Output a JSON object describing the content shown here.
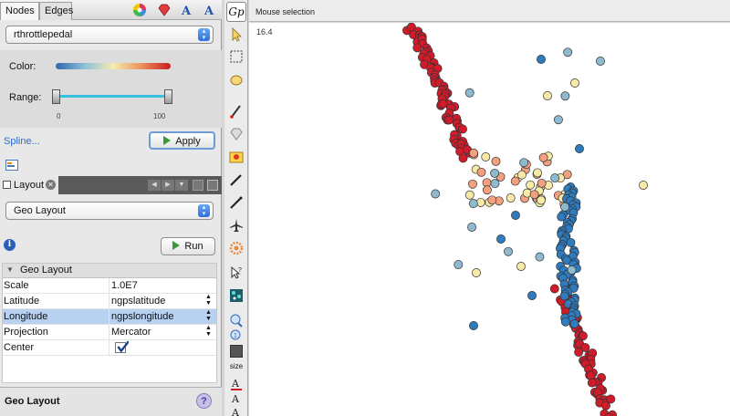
{
  "left_panel": {
    "tabs": [
      "Nodes",
      "Edges"
    ],
    "ranking": {
      "attribute": "rthrottlepedal",
      "color_label": "Color:",
      "range_label": "Range:",
      "range_min": "0",
      "range_max": "100",
      "spline_link": "Spline...",
      "apply_button": "Apply",
      "range_low_percent": 0,
      "range_high_percent": 100
    },
    "layout_panel": {
      "tab_label": "Layout",
      "selected_layout": "Geo Layout",
      "run_button": "Run",
      "section_title": "Geo Layout",
      "properties": [
        {
          "key": "Scale",
          "value": "1.0E7"
        },
        {
          "key": "Latitude",
          "value": "ngpslatitude"
        },
        {
          "key": "Longitude",
          "value": "ngpslongitude"
        },
        {
          "key": "Projection",
          "value": "Mercator"
        },
        {
          "key": "Center",
          "value": ""
        }
      ],
      "center_checked": true,
      "footer_title": "Geo Layout",
      "help_glyph": "?"
    }
  },
  "toolbar": {
    "size_label": "size"
  },
  "graph": {
    "mode_label": "Mouse selection",
    "zoom_text": "16.4"
  },
  "colors": {
    "red": "#d01b2a",
    "blue": "#2e7bbf",
    "light_blue": "#8fb9cf",
    "cream": "#f8eaa6",
    "salmon": "#f2a07e",
    "selection": "#b9d1f0"
  }
}
